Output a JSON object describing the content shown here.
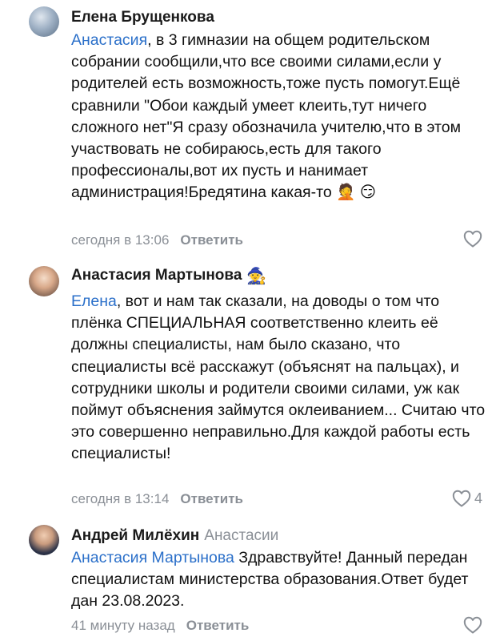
{
  "comments": [
    {
      "author": "Елена Брущенкова",
      "author_emoji": "",
      "reply_to": "",
      "mention": "Анастасия",
      "text": ", в 3 гимназии на общем родительском собрании сообщили,что все своими силами,если у родителей есть возможность,тоже пусть помогут.Ещё сравнили \"Обои каждый умеет клеить,тут ничего сложного нет\"Я сразу обозначила учителю,что в этом участвовать не собираюсь,есть для такого профессионалы,вот их пусть и нанимает администрация!Бредятина какая-то 🤦 😏",
      "time": "сегодня в 13:06",
      "reply_label": "Ответить",
      "likes": ""
    },
    {
      "author": "Анастасия Мартынова",
      "author_emoji": "🧙",
      "reply_to": "",
      "mention": "Елена",
      "text": ", вот и нам так сказали, на доводы о том что плёнка СПЕЦИАЛЬНАЯ соответственно клеить её должны специалисты, нам было сказано, что специалисты всё расскажут (объяснят на пальцах), и сотрудники школы и родители своими силами, уж как поймут объяснения займутся оклеиванием... Считаю что это совершенно неправильно.Для каждой работы есть специалисты!",
      "time": "сегодня в 13:14",
      "reply_label": "Ответить",
      "likes": "4"
    },
    {
      "author": "Андрей Милёхин",
      "author_emoji": "",
      "reply_to": "Анастасии",
      "mention": "Анастасия Мартынова",
      "text": " Здравствуйте! Данный передан специалистам министерства образования.Ответ будет дан 23.08.2023.",
      "time": "41 минуту назад",
      "reply_label": "Ответить",
      "likes": ""
    }
  ],
  "colors": {
    "mention": "#2a6fc9",
    "secondary": "#8a8f96",
    "text": "#111111"
  },
  "icons": {
    "like": "heart-outline-icon"
  }
}
